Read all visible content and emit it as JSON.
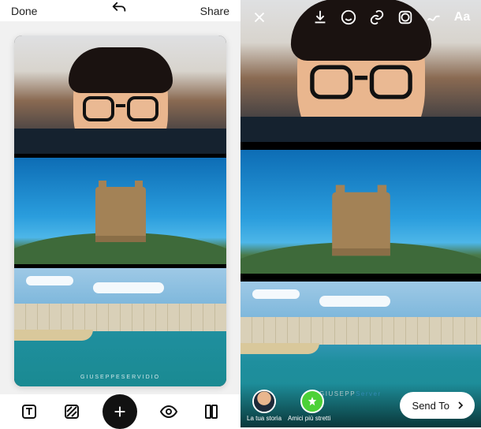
{
  "left": {
    "header": {
      "done": "Done",
      "share": "Share"
    },
    "photos": {
      "watermark": "GIUSEPPESERVIDIO"
    },
    "toolbar": {
      "text_icon": "text-tool-icon",
      "texture_icon": "texture-tool-icon",
      "add_icon": "add-icon",
      "eye_icon": "preview-icon",
      "layout_icon": "layout-icon"
    }
  },
  "right": {
    "header": {
      "text_label": "Aa"
    },
    "footer": {
      "your_story": "La tua storia",
      "close_friends": "Amici più stretti",
      "send_to": "Send To"
    },
    "watermark": {
      "a": "GIUSEPP",
      "b": "Server"
    }
  }
}
